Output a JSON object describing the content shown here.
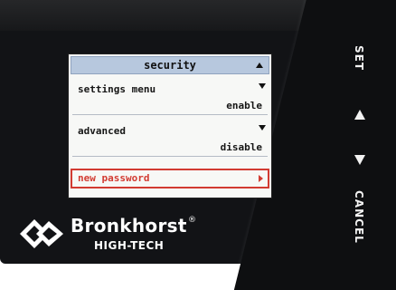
{
  "device": {
    "keys": {
      "set_label": "SET",
      "up_label": "▲",
      "down_label": "▼",
      "cancel_label": "CANCEL"
    },
    "brand": {
      "name": "Bronkhorst",
      "registered": "®",
      "subtitle": "HIGH-TECH"
    }
  },
  "screen": {
    "title": "security",
    "title_indicator": "up-triangle",
    "items": [
      {
        "label": "settings menu",
        "value": "enable",
        "indicator": "down-triangle"
      },
      {
        "label": "advanced",
        "value": "disable",
        "indicator": "down-triangle"
      }
    ],
    "selected_item": {
      "label": "new password",
      "indicator": "right-triangle"
    }
  },
  "colors": {
    "title_bar": "#b7c8de",
    "highlight": "#d23b32",
    "device_body": "#121316"
  }
}
